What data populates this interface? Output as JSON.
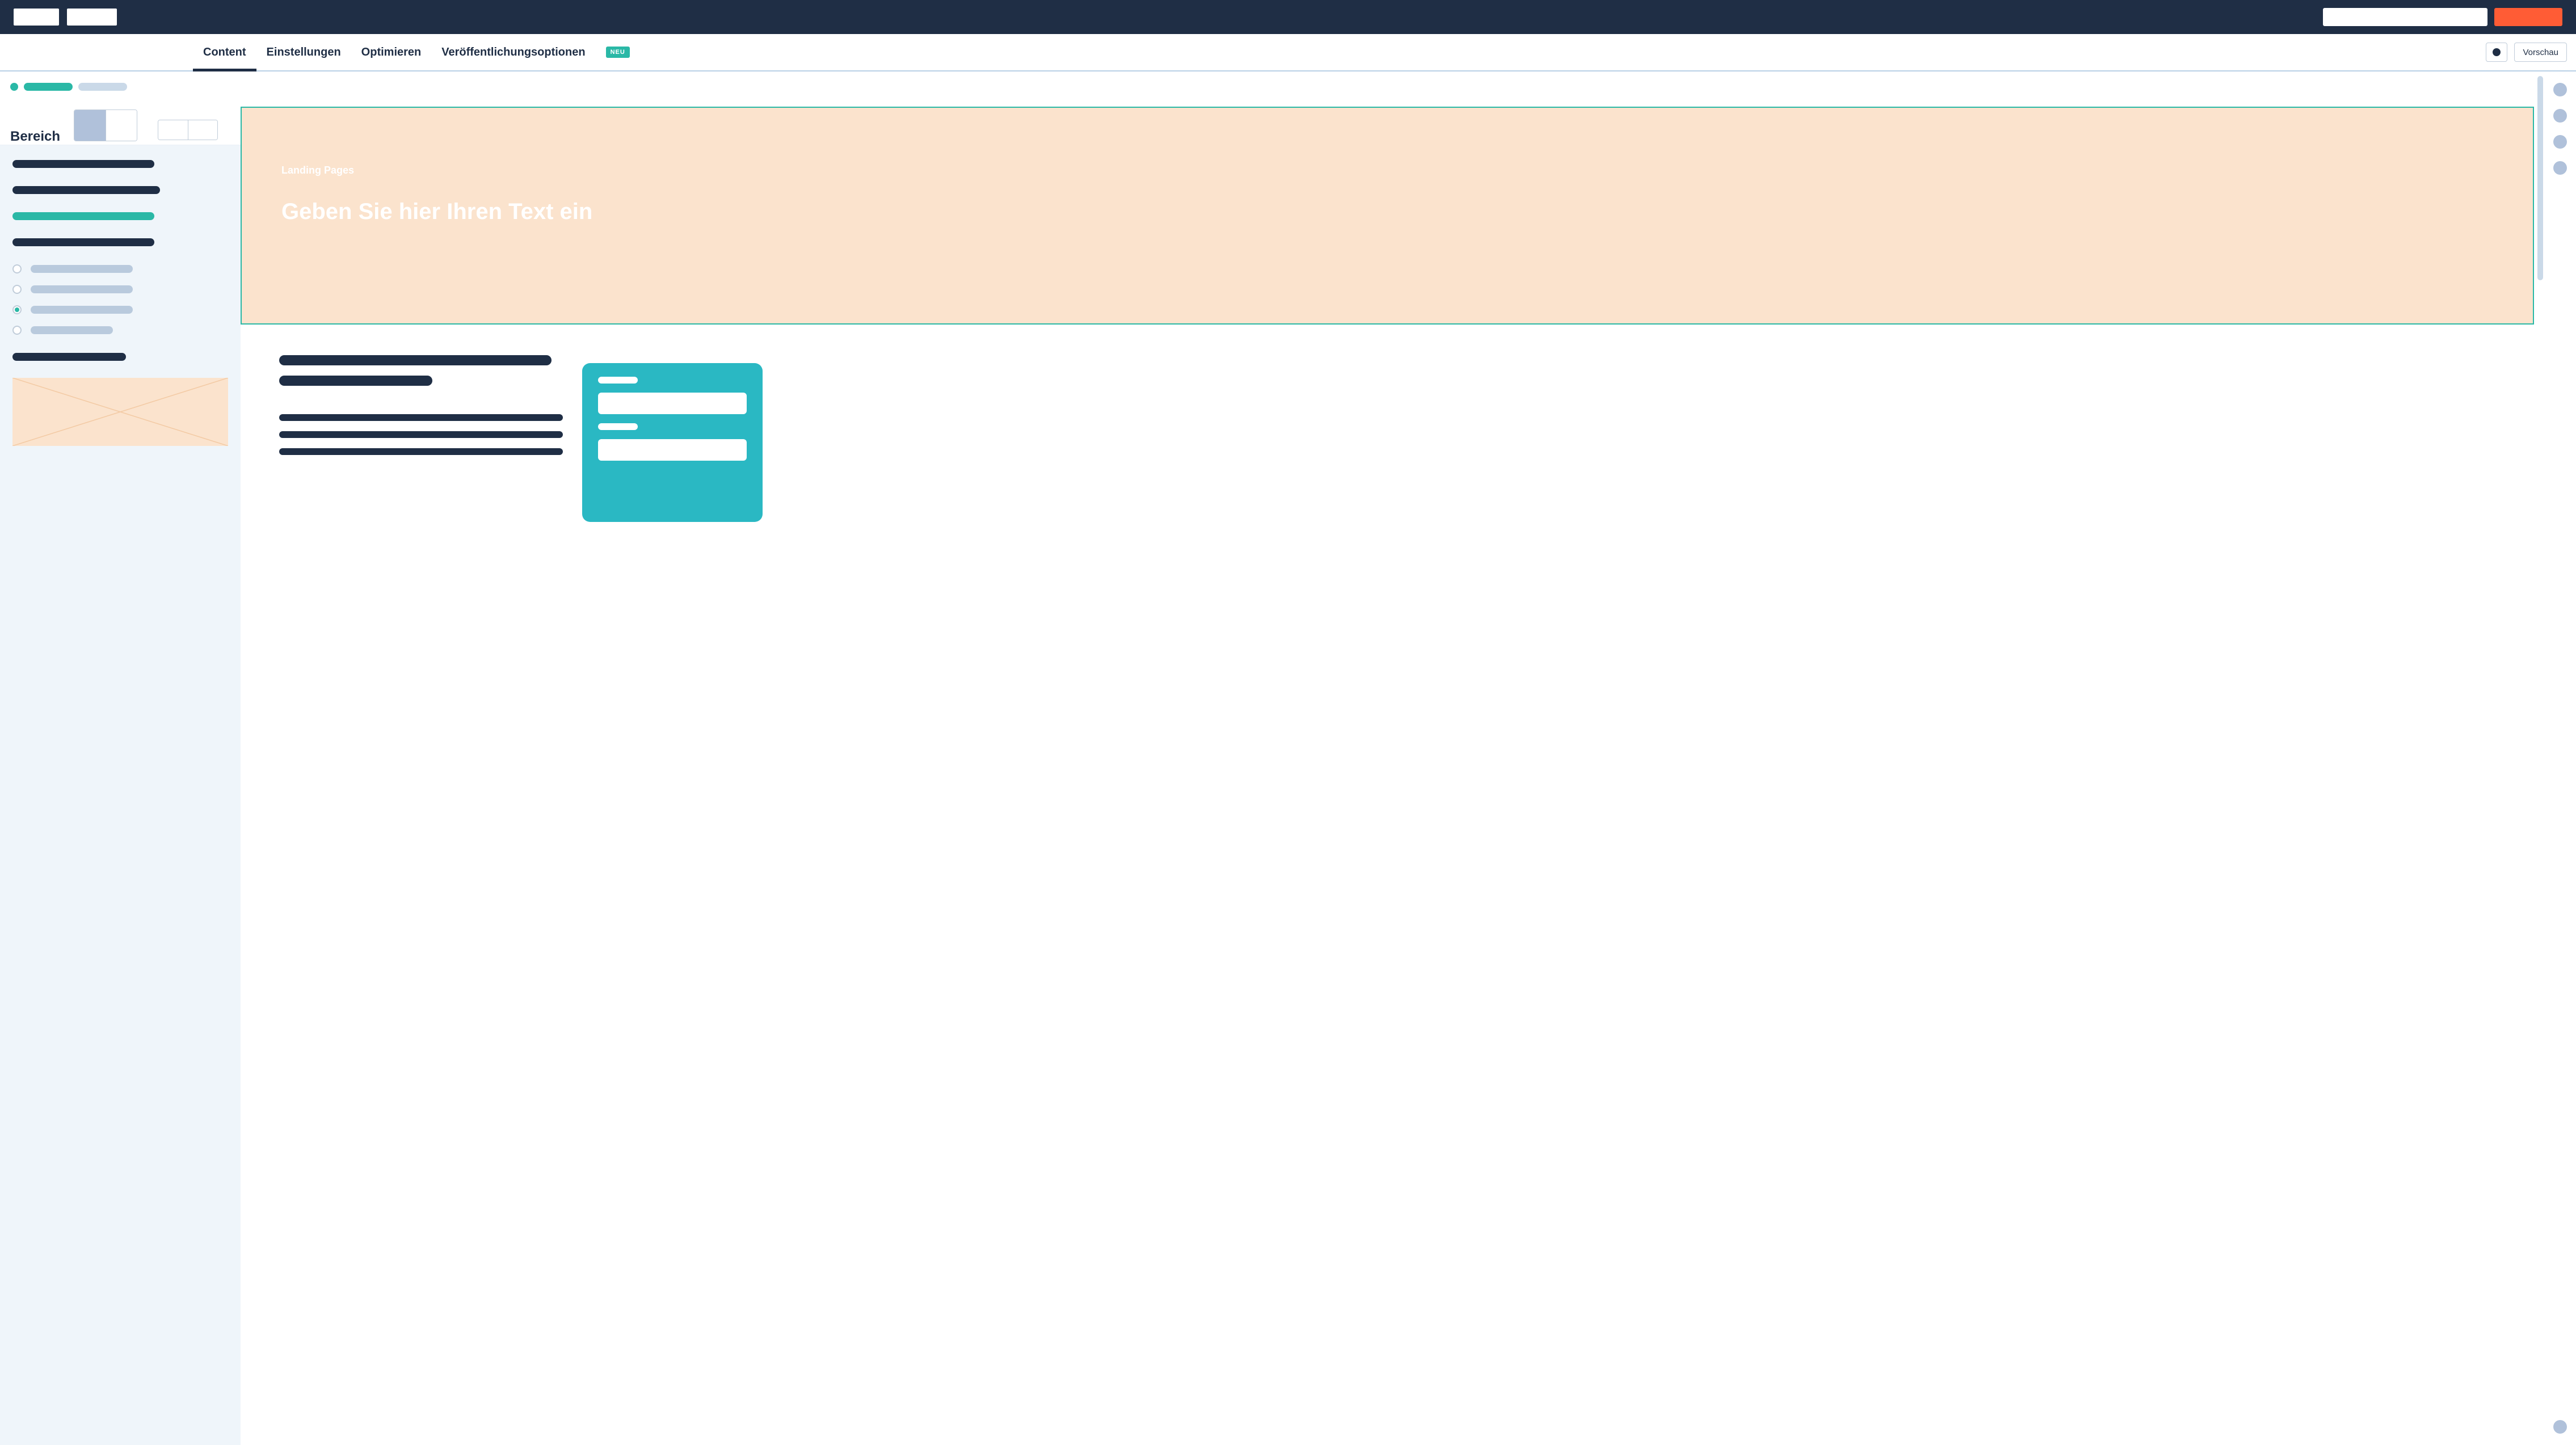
{
  "tabs": {
    "items": [
      {
        "label": "Content",
        "active": true
      },
      {
        "label": "Einstellungen",
        "active": false
      },
      {
        "label": "Optimieren",
        "active": false
      },
      {
        "label": "Veröffentlichungsoptionen",
        "active": false
      }
    ],
    "new_badge": "NEU",
    "preview_label": "Vorschau"
  },
  "sidebar": {
    "section_title": "Bereich"
  },
  "hero": {
    "eyebrow": "Landing Pages",
    "headline": "Geben Sie hier Ihren Text ein"
  },
  "colors": {
    "accent_orange": "#ff5c35",
    "accent_teal": "#2ab8a6",
    "dark": "#1f2e45"
  }
}
